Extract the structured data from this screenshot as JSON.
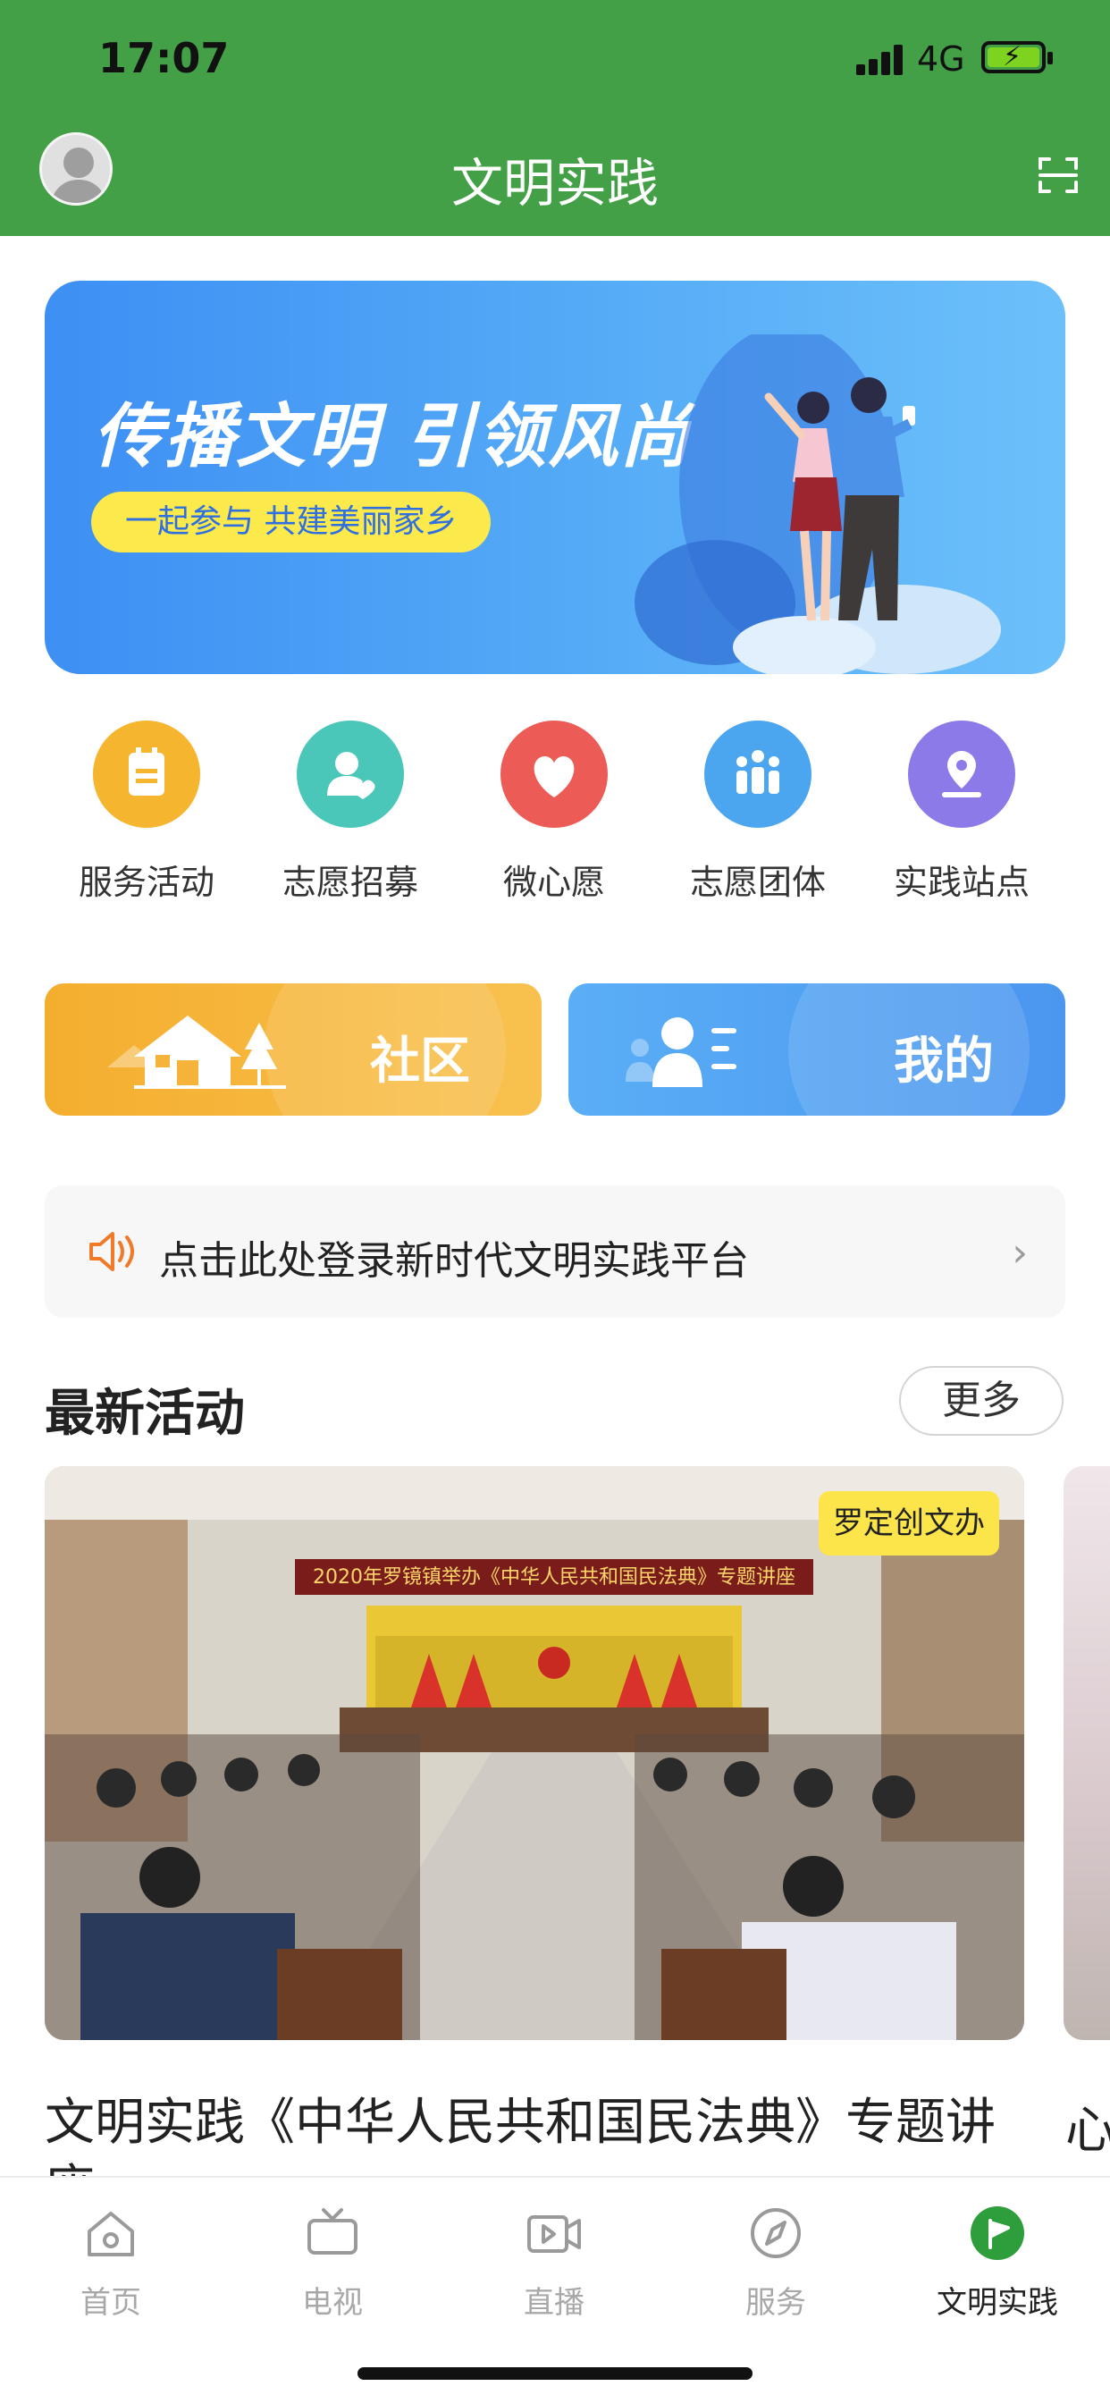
{
  "status": {
    "time": "17:07",
    "network": "4G"
  },
  "header": {
    "title": "文明实践"
  },
  "banner": {
    "headline": "传播文明 引领风尚",
    "tagline": "一起参与 共建美丽家乡"
  },
  "shortcuts": [
    {
      "label": "服务活动",
      "icon": "calendar-icon",
      "color": "#f5b52e"
    },
    {
      "label": "志愿招募",
      "icon": "person-heart-icon",
      "color": "#4ac7b9"
    },
    {
      "label": "微心愿",
      "icon": "heart-icon",
      "color": "#ec5b55"
    },
    {
      "label": "志愿团体",
      "icon": "group-icon",
      "color": "#4ba6ef"
    },
    {
      "label": "实践站点",
      "icon": "location-pin-icon",
      "color": "#8b7ae8"
    }
  ],
  "big_buttons": {
    "community": {
      "label": "社区",
      "color": "#f5b33a"
    },
    "mine": {
      "label": "我的",
      "color": "#4b9cf2"
    }
  },
  "notice": {
    "text": "点击此处登录新时代文明实践平台"
  },
  "section": {
    "title": "最新活动",
    "more_label": "更多"
  },
  "activity": {
    "tag": "罗定创文办",
    "banner_text": "2020年罗镜镇举办《中华人民共和国民法典》专题讲座",
    "title": "文明实践《中华人民共和国民法典》专题讲座",
    "next_title": "心"
  },
  "tabbar": [
    {
      "label": "首页",
      "icon": "home-icon",
      "active": false
    },
    {
      "label": "电视",
      "icon": "tv-icon",
      "active": false
    },
    {
      "label": "直播",
      "icon": "live-video-icon",
      "active": false
    },
    {
      "label": "服务",
      "icon": "compass-icon",
      "active": false
    },
    {
      "label": "文明实践",
      "icon": "flag-icon",
      "active": true
    }
  ],
  "colors": {
    "header_green": "#43a047",
    "accent_green": "#2e9d3b"
  }
}
